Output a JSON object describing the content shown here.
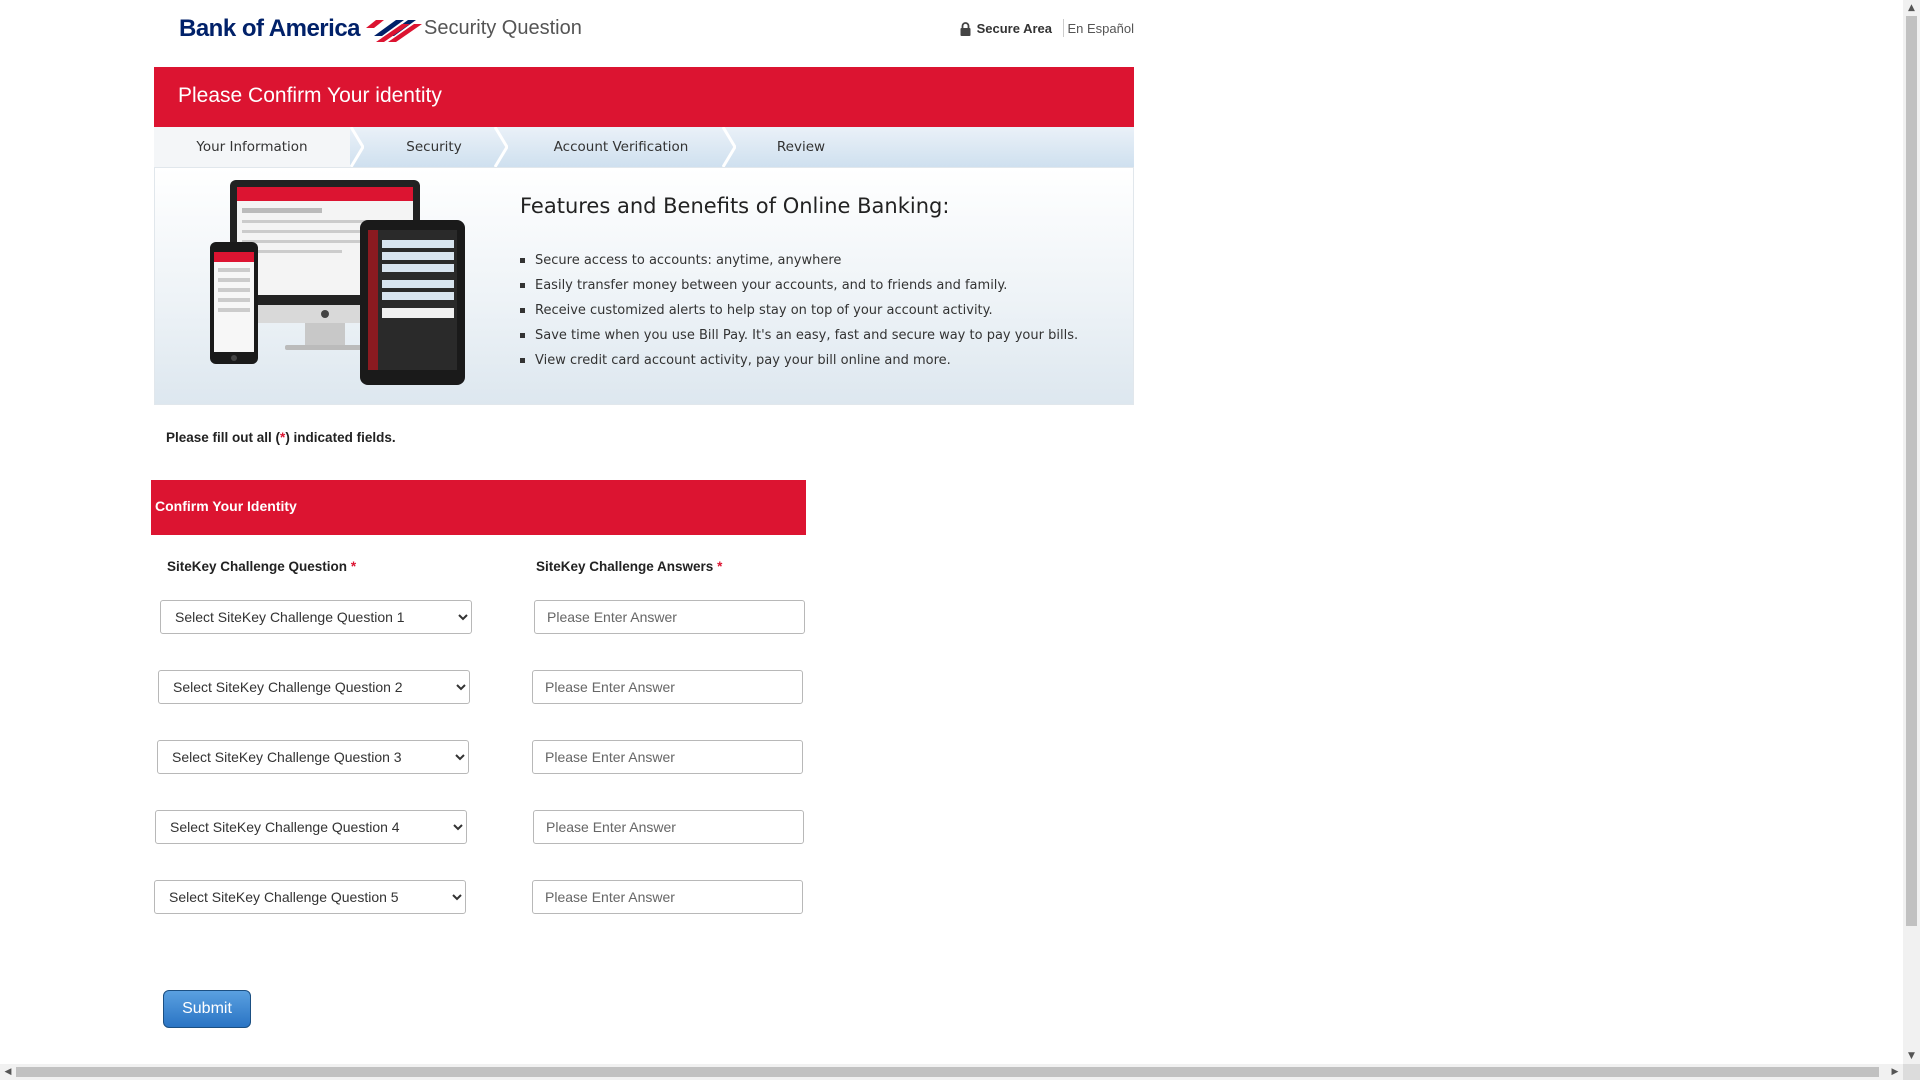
{
  "header": {
    "logo_text": "Bank of America",
    "page_name": "Security Question",
    "secure_area": "Secure Area",
    "language_link": "En Español"
  },
  "title_bar": {
    "title": "Please Confirm Your identity"
  },
  "steps": [
    "Your Information",
    "Security",
    "Account Verification",
    "Review"
  ],
  "features": {
    "heading": "Features and Benefits of Online Banking:",
    "items": [
      "Secure access to accounts: anytime, anywhere",
      "Easily transfer money between your accounts, and to friends and family.",
      "Receive customized alerts to help stay on top of your account activity.",
      "Save time when you use Bill Pay. It's an easy, fast and secure way to pay your bills.",
      "View credit card account activity, pay your bill online and more."
    ]
  },
  "instruction": {
    "before": "Please fill out all (",
    "star": "*",
    "after": ") indicated fields."
  },
  "confirm": {
    "title": "Confirm Your Identity",
    "question_label": "SiteKey Challenge Question",
    "answer_label": "SiteKey Challenge Answers",
    "required_mark": "*",
    "questions": [
      "Select SiteKey Challenge Question 1",
      "Select SiteKey Challenge Question 2",
      "Select SiteKey Challenge Question 3",
      "Select SiteKey Challenge Question 4",
      "Select SiteKey Challenge Question 5"
    ],
    "answer_placeholder": "Please Enter Answer",
    "submit_label": "Submit"
  },
  "colors": {
    "brand_red": "#dc1431",
    "brand_blue": "#012169",
    "button_blue": "#2a74c4"
  },
  "icons": {
    "lock": "lock-icon",
    "flag": "flag-logo-icon"
  }
}
